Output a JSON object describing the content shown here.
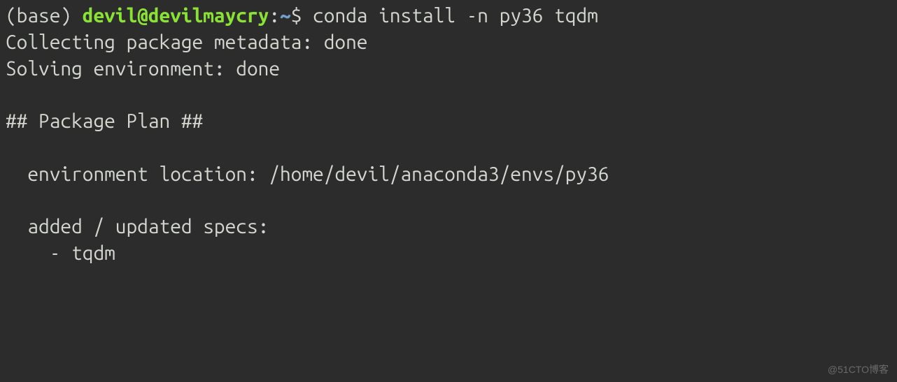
{
  "prompt": {
    "base": "(base) ",
    "user_host": "devil@devilmaycry",
    "separator": ":",
    "path": "~",
    "dollar": "$ "
  },
  "command": "conda install -n py36 tqdm",
  "output": {
    "line1": "Collecting package metadata: done",
    "line2": "Solving environment: done",
    "line3": "",
    "line4": "## Package Plan ##",
    "line5": "",
    "line6": "  environment location: /home/devil/anaconda3/envs/py36",
    "line7": "",
    "line8": "  added / updated specs:",
    "line9": "    - tqdm",
    "line10": ""
  },
  "watermark": "@51CTO博客"
}
